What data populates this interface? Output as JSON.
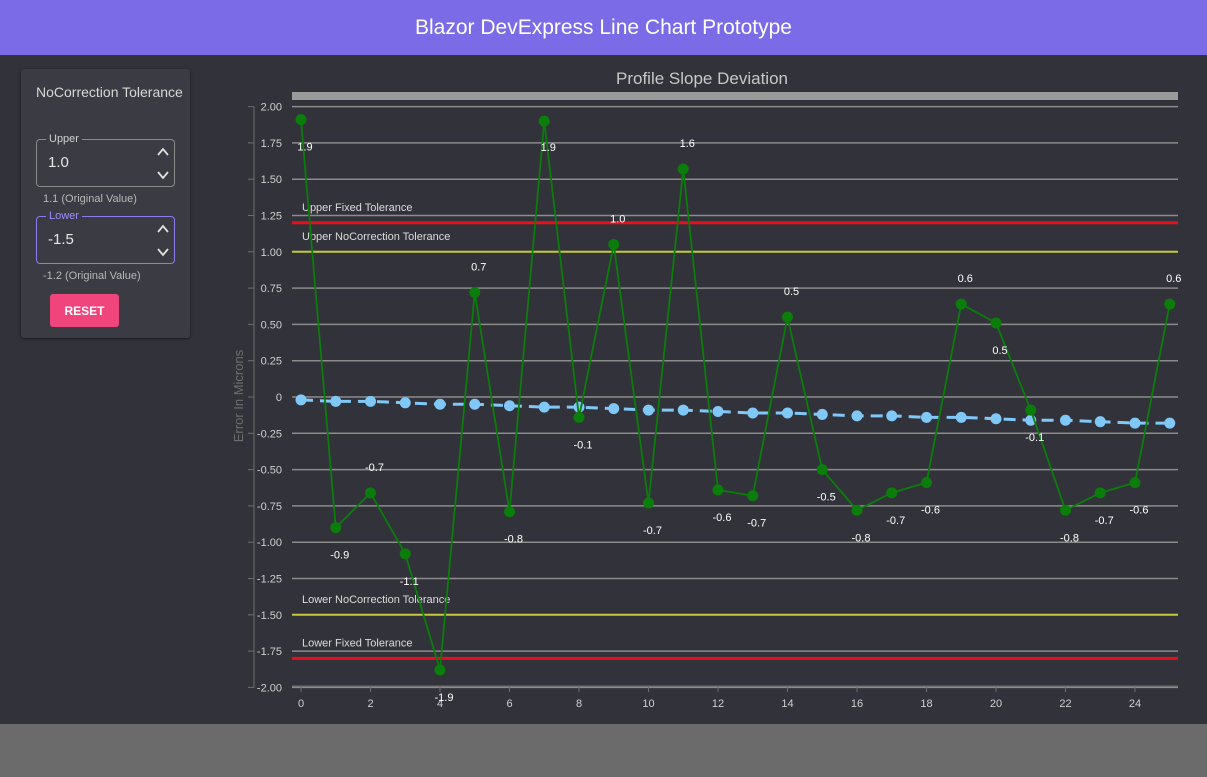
{
  "header": {
    "title": "Blazor DevExpress Line Chart Prototype"
  },
  "panel": {
    "title": "NoCorrection Tolerance",
    "upper": {
      "label": "Upper",
      "value": "1.0",
      "hint": "1.1 (Original Value)"
    },
    "lower": {
      "label": "Lower",
      "value": "-1.5",
      "hint": "-1.2 (Original Value)"
    },
    "reset_label": "RESET"
  },
  "colors": {
    "header": "#7b6be6",
    "reset": "#f0447c",
    "series": "#0a7d0a",
    "trend": "#80c8f8",
    "fixed_tol": "#e8101c",
    "nocorr_tol": "#c8c83c"
  },
  "chart_data": {
    "type": "line",
    "title": "Profile Slope Deviation",
    "ylabel": "Error In Microns",
    "xlim": [
      0,
      25
    ],
    "ylim": [
      -2,
      2
    ],
    "x_ticks": [
      0,
      2,
      4,
      6,
      8,
      10,
      12,
      14,
      16,
      18,
      20,
      22,
      24
    ],
    "y_ticks": [
      "2.00",
      "1.75",
      "1.50",
      "1.25",
      "1.00",
      "0.75",
      "0.50",
      "0.25",
      "0",
      "-0.25",
      "-0.50",
      "-0.75",
      "-1.00",
      "-1.25",
      "-1.50",
      "-1.75",
      "-2.00"
    ],
    "grid": true,
    "series": [
      {
        "x": [
          0,
          1,
          2,
          3,
          4,
          5,
          6,
          7,
          8,
          9,
          10,
          11,
          12,
          13,
          14,
          15,
          16,
          17,
          18,
          19,
          20,
          21,
          22,
          23,
          24,
          25
        ],
        "values": [
          1.91,
          -0.9,
          -0.66,
          -1.08,
          -1.88,
          0.72,
          -0.79,
          1.9,
          -0.14,
          1.05,
          -0.73,
          1.57,
          -0.64,
          -0.68,
          0.55,
          -0.5,
          -0.78,
          -0.66,
          -0.59,
          0.64,
          0.51,
          -0.09,
          -0.78,
          -0.66,
          -0.59,
          0.64
        ],
        "labels": [
          "1.9",
          "-0.9",
          "-0.7",
          "-1.1",
          "-1.9",
          "0.7",
          "-0.8",
          "1.9",
          "-0.1",
          "1.0",
          "-0.7",
          "1.6",
          "-0.6",
          "-0.7",
          "0.5",
          "-0.5",
          "-0.8",
          "-0.7",
          "-0.6",
          "0.6",
          "0.5",
          "-0.1",
          "-0.8",
          "-0.7",
          "-0.6",
          "0.6"
        ]
      },
      {
        "x": [
          0,
          1,
          2,
          3,
          4,
          5,
          6,
          7,
          8,
          9,
          10,
          11,
          12,
          13,
          14,
          15,
          16,
          17,
          18,
          19,
          20,
          21,
          22,
          23,
          24,
          25
        ],
        "values": [
          -0.02,
          -0.03,
          -0.03,
          -0.04,
          -0.05,
          -0.05,
          -0.06,
          -0.07,
          -0.07,
          -0.08,
          -0.09,
          -0.09,
          -0.1,
          -0.11,
          -0.11,
          -0.12,
          -0.13,
          -0.13,
          -0.14,
          -0.14,
          -0.15,
          -0.16,
          -0.16,
          -0.17,
          -0.18,
          -0.18
        ]
      }
    ],
    "constant_lines": [
      {
        "label": "Upper Fixed Tolerance",
        "value": 1.2,
        "kind": "fixed"
      },
      {
        "label": "Upper NoCorrection Tolerance",
        "value": 1.0,
        "kind": "nocorr"
      },
      {
        "label": "Lower NoCorrection Tolerance",
        "value": -1.5,
        "kind": "nocorr"
      },
      {
        "label": "Lower Fixed Tolerance",
        "value": -1.8,
        "kind": "fixed"
      }
    ]
  }
}
